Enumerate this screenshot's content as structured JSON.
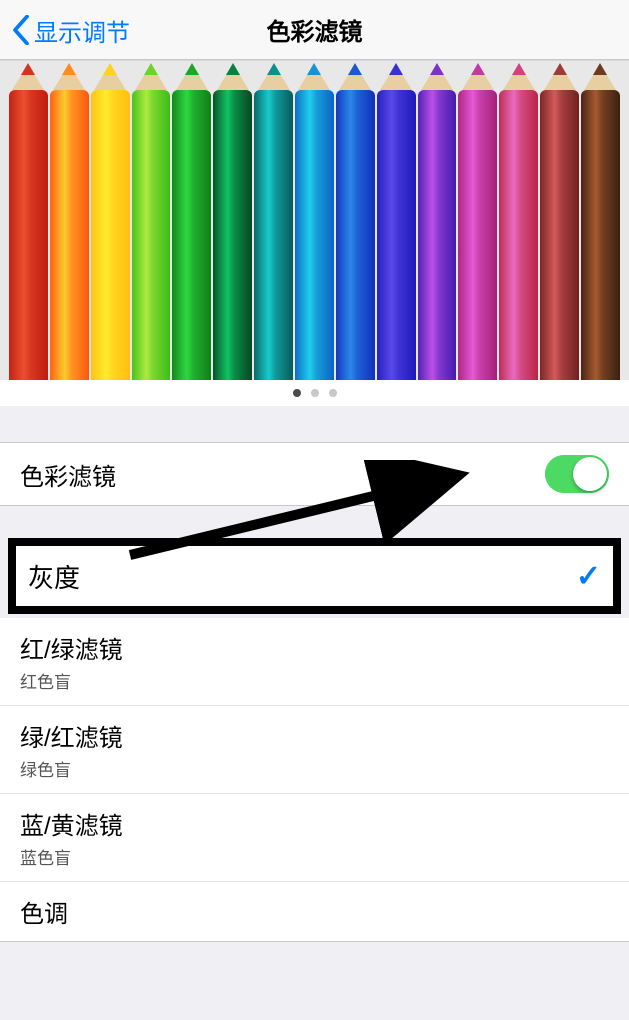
{
  "nav": {
    "back_label": "显示调节",
    "title": "色彩滤镜"
  },
  "pencil_colors": [
    "#d4331f",
    "#ff8a1e",
    "#ffd21e",
    "#6fd22a",
    "#1da72a",
    "#0a7f3f",
    "#0f8e8e",
    "#1593d6",
    "#1c58d0",
    "#3a2fd0",
    "#7a33c9",
    "#c13aa2",
    "#d0447d",
    "#9e3a3a",
    "#6b3a1f"
  ],
  "toggle_row": {
    "label": "色彩滤镜",
    "on": true
  },
  "filters": [
    {
      "label": "灰度",
      "sub": "",
      "selected": true
    },
    {
      "label": "红/绿滤镜",
      "sub": "红色盲",
      "selected": false
    },
    {
      "label": "绿/红滤镜",
      "sub": "绿色盲",
      "selected": false
    },
    {
      "label": "蓝/黄滤镜",
      "sub": "蓝色盲",
      "selected": false
    },
    {
      "label": "色调",
      "sub": "",
      "selected": false
    }
  ],
  "pager": {
    "count": 3,
    "active": 0
  }
}
